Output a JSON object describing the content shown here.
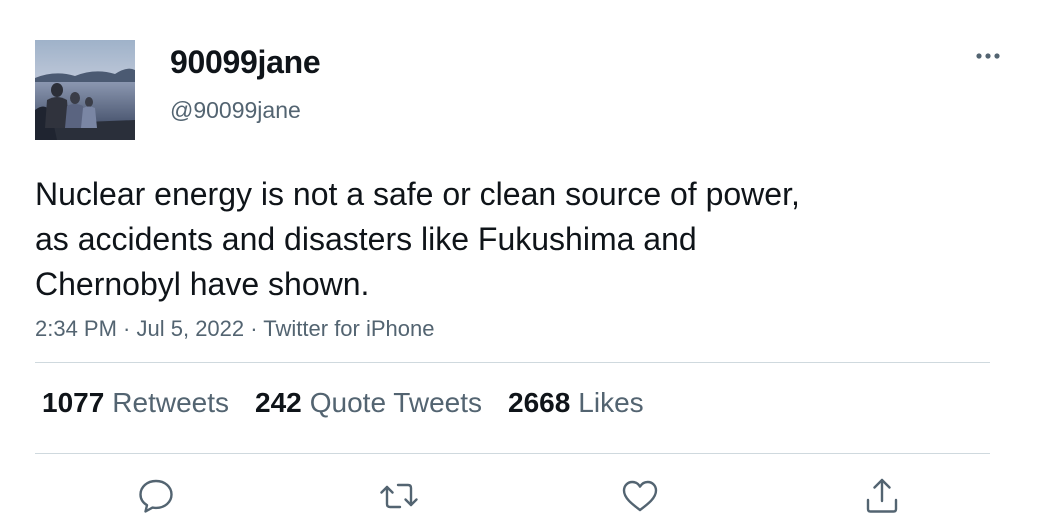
{
  "user": {
    "display_name": "90099jane",
    "handle": "@90099jane"
  },
  "tweet": {
    "lines": [
      "Nuclear energy is not a safe or clean source of power,",
      "as accidents and disasters like Fukushima and",
      "Chernobyl have shown."
    ],
    "time": "2:34 PM",
    "separator": " · ",
    "date": "Jul 5, 2022",
    "source": "Twitter for iPhone"
  },
  "stats": {
    "retweets": {
      "count": "1077",
      "label": "Retweets"
    },
    "quotes": {
      "count": "242",
      "label": "Quote Tweets"
    },
    "likes": {
      "count": "2668",
      "label": "Likes"
    }
  },
  "icons": {
    "more": "more-horizontal-icon",
    "reply": "reply-icon",
    "retweet": "retweet-icon",
    "like": "heart-icon",
    "share": "share-icon"
  },
  "colors": {
    "text_primary": "#0f1419",
    "text_secondary": "#536471",
    "divider": "#cfd9de"
  }
}
